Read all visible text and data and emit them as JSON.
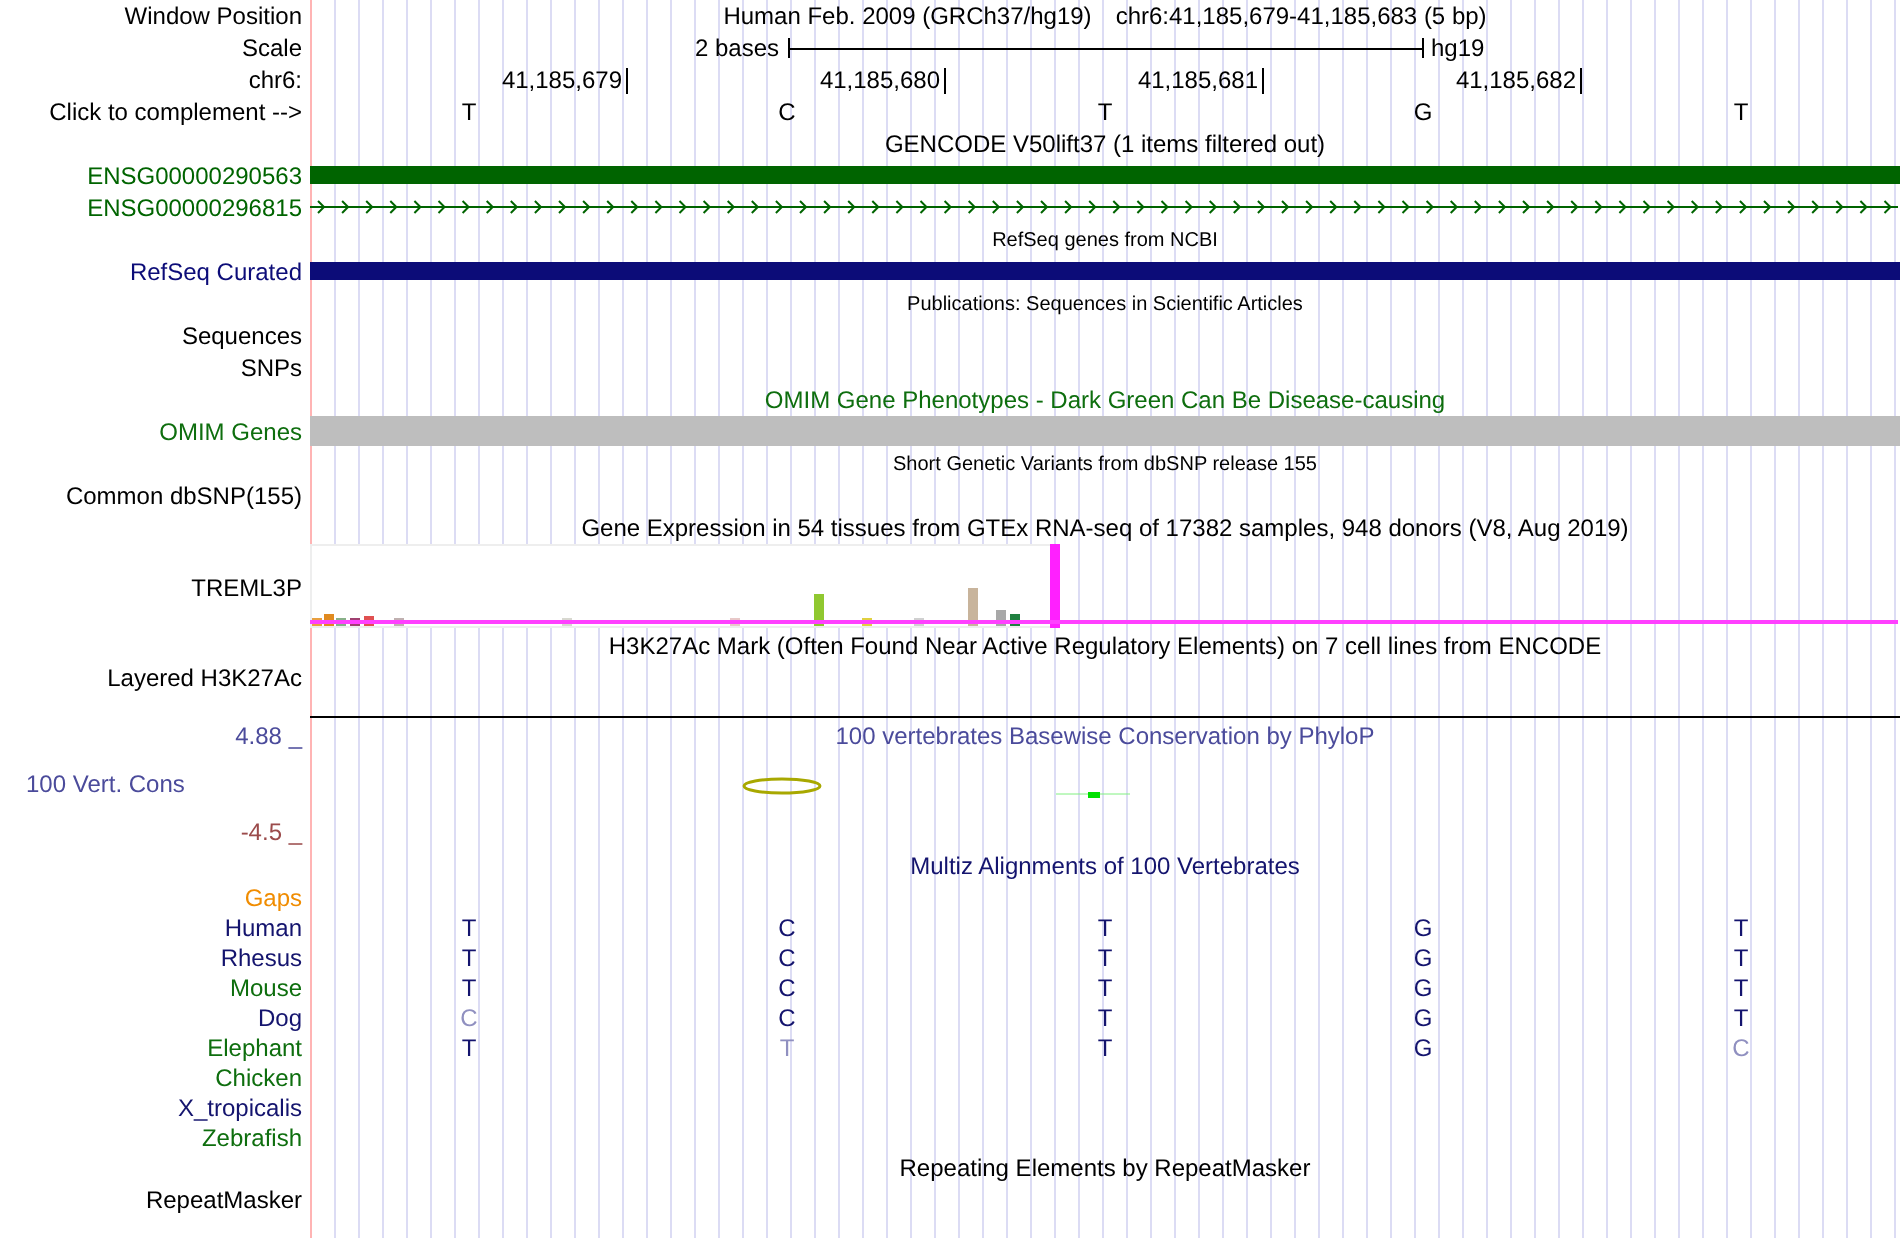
{
  "header": {
    "window_position": {
      "label": "Window Position",
      "assembly": "Human Feb. 2009 (GRCh37/hg19)",
      "range": "chr6:41,185,679-41,185,683 (5 bp)"
    },
    "scale": {
      "label": "Scale",
      "span": "2 bases",
      "assembly": "hg19"
    },
    "ruler": {
      "label": "chr6:",
      "positions": [
        "41,185,679",
        "41,185,680",
        "41,185,681",
        "41,185,682"
      ]
    },
    "complement": {
      "label": "Click to complement -->",
      "bases": [
        "T",
        "C",
        "T",
        "G",
        "T"
      ]
    }
  },
  "tracks": [
    {
      "kind": "title",
      "text": "GENCODE V50lift37 (1 items filtered out)",
      "color": "#000000"
    },
    {
      "kind": "bar",
      "label": "ENSG00000290563",
      "color": "#006400"
    },
    {
      "kind": "arrows",
      "label": "ENSG00000296815",
      "color": "#006400"
    },
    {
      "kind": "subtitle",
      "text": "RefSeq genes from NCBI"
    },
    {
      "kind": "bar",
      "label": "RefSeq Curated",
      "color": "#0c0c78"
    },
    {
      "kind": "subtitle",
      "text": "Publications: Sequences in Scientific Articles"
    },
    {
      "kind": "empty",
      "label": "Sequences"
    },
    {
      "kind": "empty",
      "label": "SNPs"
    },
    {
      "kind": "title",
      "text": "OMIM Gene Phenotypes - Dark Green Can Be Disease-causing",
      "color": "#0e6e0e"
    },
    {
      "kind": "block",
      "label": "OMIM Genes",
      "color": "#0e6e0e"
    },
    {
      "kind": "subtitle",
      "text": "Short Genetic Variants from dbSNP release 155"
    },
    {
      "kind": "empty",
      "label": "Common dbSNP(155)"
    },
    {
      "kind": "title",
      "text": "Gene Expression in 54 tissues from GTEx RNA-seq of 17382 samples, 948 donors (V8, Aug 2019)",
      "color": "#000000"
    },
    {
      "kind": "expression",
      "label": "TREML3P"
    },
    {
      "kind": "title",
      "text": "H3K27Ac Mark (Often Found Near Active Regulatory Elements) on 7 cell lines from ENCODE",
      "color": "#000000"
    },
    {
      "kind": "layered",
      "label": "Layered H3K27Ac"
    },
    {
      "kind": "conservation",
      "title": "100 vertebrates Basewise Conservation by PhyloP",
      "label": "100 Vert. Cons",
      "max": "4.88 _",
      "min": "-4.5 _"
    },
    {
      "kind": "title",
      "text": "Multiz Alignments of 100 Vertebrates",
      "color": "#14146e"
    },
    {
      "kind": "gaps",
      "label": "Gaps"
    },
    {
      "kind": "species",
      "label": "Human",
      "color": "#14146e",
      "bases": [
        {
          "base": "T",
          "dimmed": false
        },
        {
          "base": "C",
          "dimmed": false
        },
        {
          "base": "T",
          "dimmed": false
        },
        {
          "base": "G",
          "dimmed": false
        },
        {
          "base": "T",
          "dimmed": false
        }
      ]
    },
    {
      "kind": "species",
      "label": "Rhesus",
      "color": "#14146e",
      "bases": [
        {
          "base": "T",
          "dimmed": false
        },
        {
          "base": "C",
          "dimmed": false
        },
        {
          "base": "T",
          "dimmed": false
        },
        {
          "base": "G",
          "dimmed": false
        },
        {
          "base": "T",
          "dimmed": false
        }
      ]
    },
    {
      "kind": "species",
      "label": "Mouse",
      "color": "#0e6e0e",
      "bases": [
        {
          "base": "T",
          "dimmed": false
        },
        {
          "base": "C",
          "dimmed": false
        },
        {
          "base": "T",
          "dimmed": false
        },
        {
          "base": "G",
          "dimmed": false
        },
        {
          "base": "T",
          "dimmed": false
        }
      ]
    },
    {
      "kind": "species",
      "label": "Dog",
      "color": "#14146e",
      "bases": [
        {
          "base": "C",
          "dimmed": true
        },
        {
          "base": "C",
          "dimmed": false
        },
        {
          "base": "T",
          "dimmed": false
        },
        {
          "base": "G",
          "dimmed": false
        },
        {
          "base": "T",
          "dimmed": false
        }
      ]
    },
    {
      "kind": "species",
      "label": "Elephant",
      "color": "#0e6e0e",
      "bases": [
        {
          "base": "T",
          "dimmed": false
        },
        {
          "base": "T",
          "dimmed": true
        },
        {
          "base": "T",
          "dimmed": false
        },
        {
          "base": "G",
          "dimmed": false
        },
        {
          "base": "C",
          "dimmed": true
        }
      ]
    },
    {
      "kind": "species",
      "label": "Chicken",
      "color": "#0e6e0e"
    },
    {
      "kind": "species",
      "label": "X_tropicalis",
      "color": "#14146e"
    },
    {
      "kind": "species",
      "label": "Zebrafish",
      "color": "#0e6e0e"
    },
    {
      "kind": "title",
      "text": "Repeating Elements by RepeatMasker",
      "color": "#000000"
    },
    {
      "kind": "empty",
      "label": "RepeatMasker"
    }
  ]
}
